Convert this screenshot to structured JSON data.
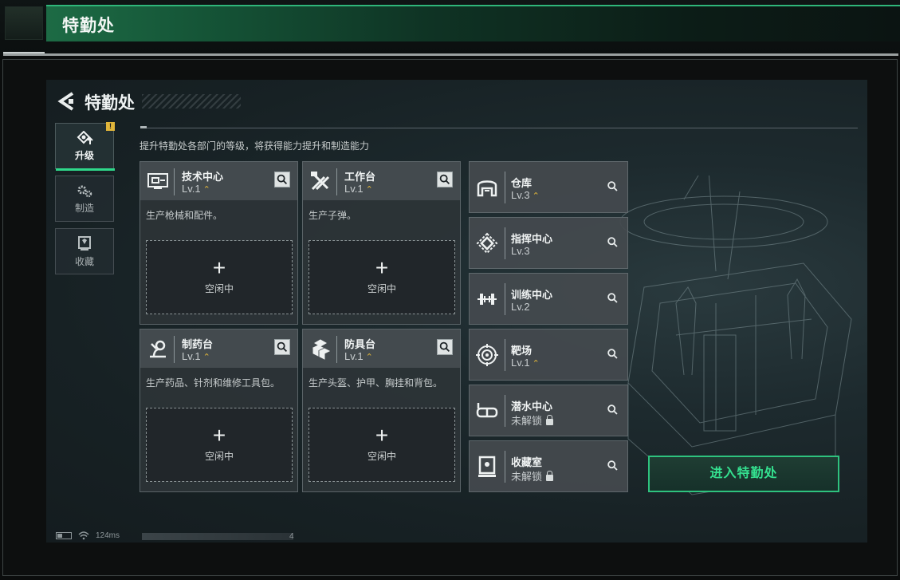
{
  "window": {
    "title": "特勤处"
  },
  "header": {
    "title": "特勤处",
    "description": "提升特勤处各部门的等级，将获得能力提升和制造能力"
  },
  "tabs": [
    {
      "label": "升级",
      "active": true,
      "icon": "upgrade-icon",
      "alert": "!"
    },
    {
      "label": "制造",
      "active": false,
      "icon": "gears-icon"
    },
    {
      "label": "收藏",
      "active": false,
      "icon": "collection-icon"
    }
  ],
  "departments": [
    {
      "name": "技术中心",
      "level": "Lv.1",
      "desc": "生产枪械和配件。",
      "slot": "空闲中",
      "icon": "tech-center-icon"
    },
    {
      "name": "工作台",
      "level": "Lv.1",
      "desc": "生产子弹。",
      "slot": "空闲中",
      "icon": "workbench-icon"
    },
    {
      "name": "制药台",
      "level": "Lv.1",
      "desc": "生产药品、针剂和维修工具包。",
      "slot": "空闲中",
      "icon": "pharmacy-icon"
    },
    {
      "name": "防具台",
      "level": "Lv.1",
      "desc": "生产头盔、护甲、胸挂和背包。",
      "slot": "空闲中",
      "icon": "armor-bench-icon"
    }
  ],
  "facilities": [
    {
      "name": "仓库",
      "level": "Lv.3",
      "upgradable": true,
      "icon": "warehouse-icon"
    },
    {
      "name": "指挥中心",
      "level": "Lv.3",
      "upgradable": false,
      "icon": "command-center-icon"
    },
    {
      "name": "训练中心",
      "level": "Lv.2",
      "upgradable": false,
      "icon": "training-icon"
    },
    {
      "name": "靶场",
      "level": "Lv.1",
      "upgradable": true,
      "icon": "target-range-icon"
    },
    {
      "name": "潜水中心",
      "level": "未解锁",
      "locked": true,
      "icon": "diving-icon"
    },
    {
      "name": "收藏室",
      "level": "未解锁",
      "locked": true,
      "icon": "collection-room-icon"
    }
  ],
  "enter_button": "进入特勤处",
  "status": {
    "ping": "124ms",
    "uid_suffix": "4"
  },
  "colors": {
    "accent": "#2ec27e",
    "upgrade": "#e0b53a",
    "panel": "#2e3438"
  }
}
